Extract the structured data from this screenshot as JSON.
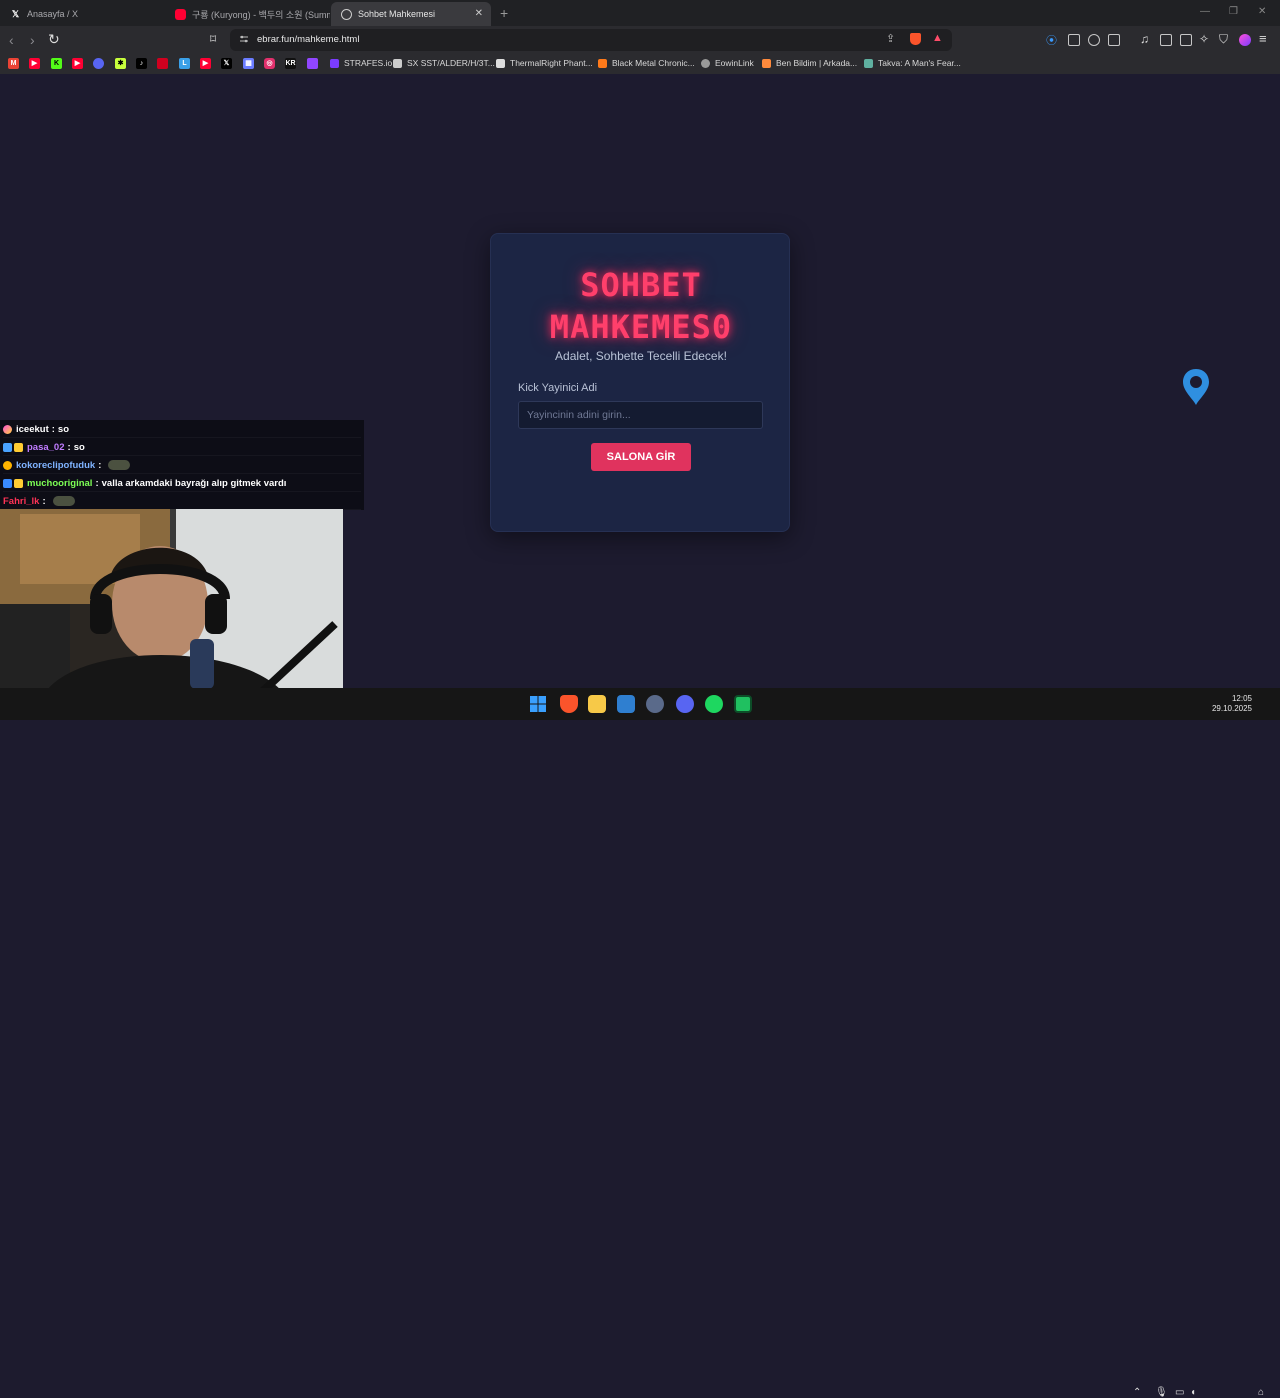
{
  "browser": {
    "tabs": [
      {
        "label": "Anasayfa / X",
        "icon": "x-logo-icon"
      },
      {
        "label": "구룡 (Kuryong) - 백두의 소원 (Summ",
        "icon": "youtube-icon"
      },
      {
        "label": "Sohbet Mahkemesi",
        "icon": "globe-icon",
        "active": true
      }
    ],
    "new_tab": "+",
    "url": "ebrar.fun/mahkeme.html",
    "bookmarks": [
      {
        "label": "STRAFES.io",
        "color": "#7b3cff"
      },
      {
        "label": "SX SST/ALDER/H/3T...",
        "color": "#cccccc"
      },
      {
        "label": "ThermalRight Phant...",
        "color": "#dddddd"
      },
      {
        "label": "Black Metal Chronic...",
        "color": "#ff7a1a"
      },
      {
        "label": "EowinLink",
        "color": "#9a9a9a"
      },
      {
        "label": "Ben Bildim | Arkada...",
        "color": "#ff8a3c"
      },
      {
        "label": "Takva: A Man's Fear...",
        "color": "#5fb0a0"
      }
    ]
  },
  "app": {
    "title_line1": "SOHBET",
    "title_line2": "MAHKEMES0",
    "subtitle": "Adalet, Sohbette Tecelli Edecek!",
    "field_label": "Kick Yayinici Adi",
    "field_placeholder": "Yayincinin adini girin...",
    "field_value": "",
    "button_label": "SALONA GİR",
    "accent": "#e0335e"
  },
  "chat": [
    {
      "user": "iceekut",
      "message": "so",
      "color": "#ffffff"
    },
    {
      "user": "pasa_02",
      "message": "so",
      "color": "#c07cff"
    },
    {
      "user": "kokoreclipofuduk",
      "message": "",
      "color": "#7fb3ff",
      "emote": true
    },
    {
      "user": "muchooriginal",
      "message": "valla arkamdaki bayrağı alıp gitmek vardı",
      "color": "#7dff55"
    },
    {
      "user": "Fahri_lk",
      "message": "",
      "color": "#ff3355",
      "emote": true
    }
  ],
  "taskbar": {
    "time": "12:05",
    "date": "29.10.2025"
  }
}
